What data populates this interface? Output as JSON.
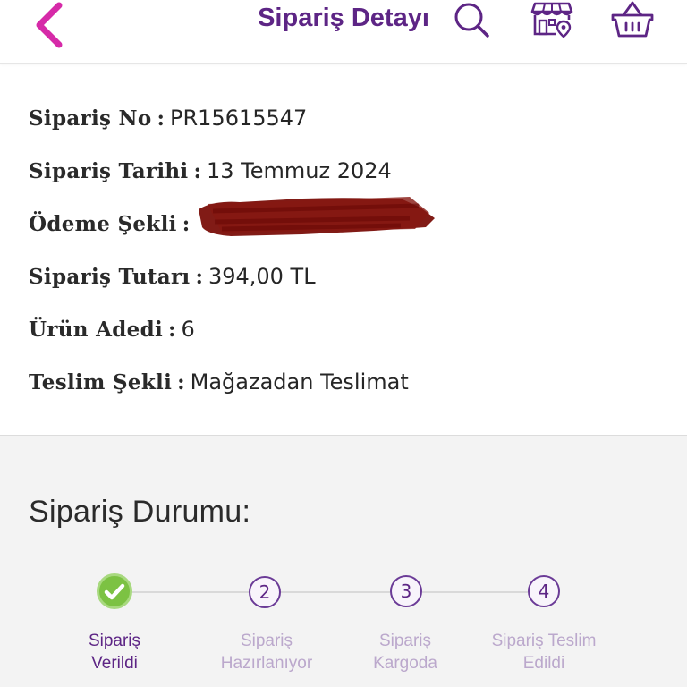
{
  "header": {
    "title": "Sipariş Detayı",
    "back_icon": "chevron-left-icon",
    "search_icon": "search-icon",
    "store_icon": "store-location-icon",
    "basket_icon": "basket-icon",
    "colors": {
      "title": "#5d2585",
      "back": "#d62aa8"
    }
  },
  "order_details": {
    "rows": [
      {
        "label": "Sipariş No",
        "separator": ":",
        "value": "PR15615547"
      },
      {
        "label": "Sipariş Tarihi",
        "separator": ":",
        "value": "13 Temmuz 2024"
      },
      {
        "label": "Ödeme Şekli",
        "separator": ":",
        "value": ""
      },
      {
        "label": "Sipariş Tutarı",
        "separator": ":",
        "value": "394,00 TL"
      },
      {
        "label": "Ürün Adedi",
        "separator": ":",
        "value": "6"
      },
      {
        "label": "Teslim Şekli",
        "separator": ":",
        "value": "Mağazadan Teslimat"
      }
    ],
    "payment_redacted": true
  },
  "status": {
    "title": "Sipariş Durumu:",
    "steps": [
      {
        "number": "",
        "label_line1": "Sipariş",
        "label_line2": "Verildi",
        "state": "completed"
      },
      {
        "number": "2",
        "label_line1": "Sipariş",
        "label_line2": "Hazırlanıyor",
        "state": "pending"
      },
      {
        "number": "3",
        "label_line1": "Sipariş",
        "label_line2": "Kargoda",
        "state": "pending"
      },
      {
        "number": "4",
        "label_line1": "Sipariş Teslim",
        "label_line2": "Edildi",
        "state": "pending"
      }
    ],
    "colors": {
      "completed": "#7cc243",
      "active_text": "#5d2585",
      "inactive_text": "#bba8cc"
    }
  }
}
